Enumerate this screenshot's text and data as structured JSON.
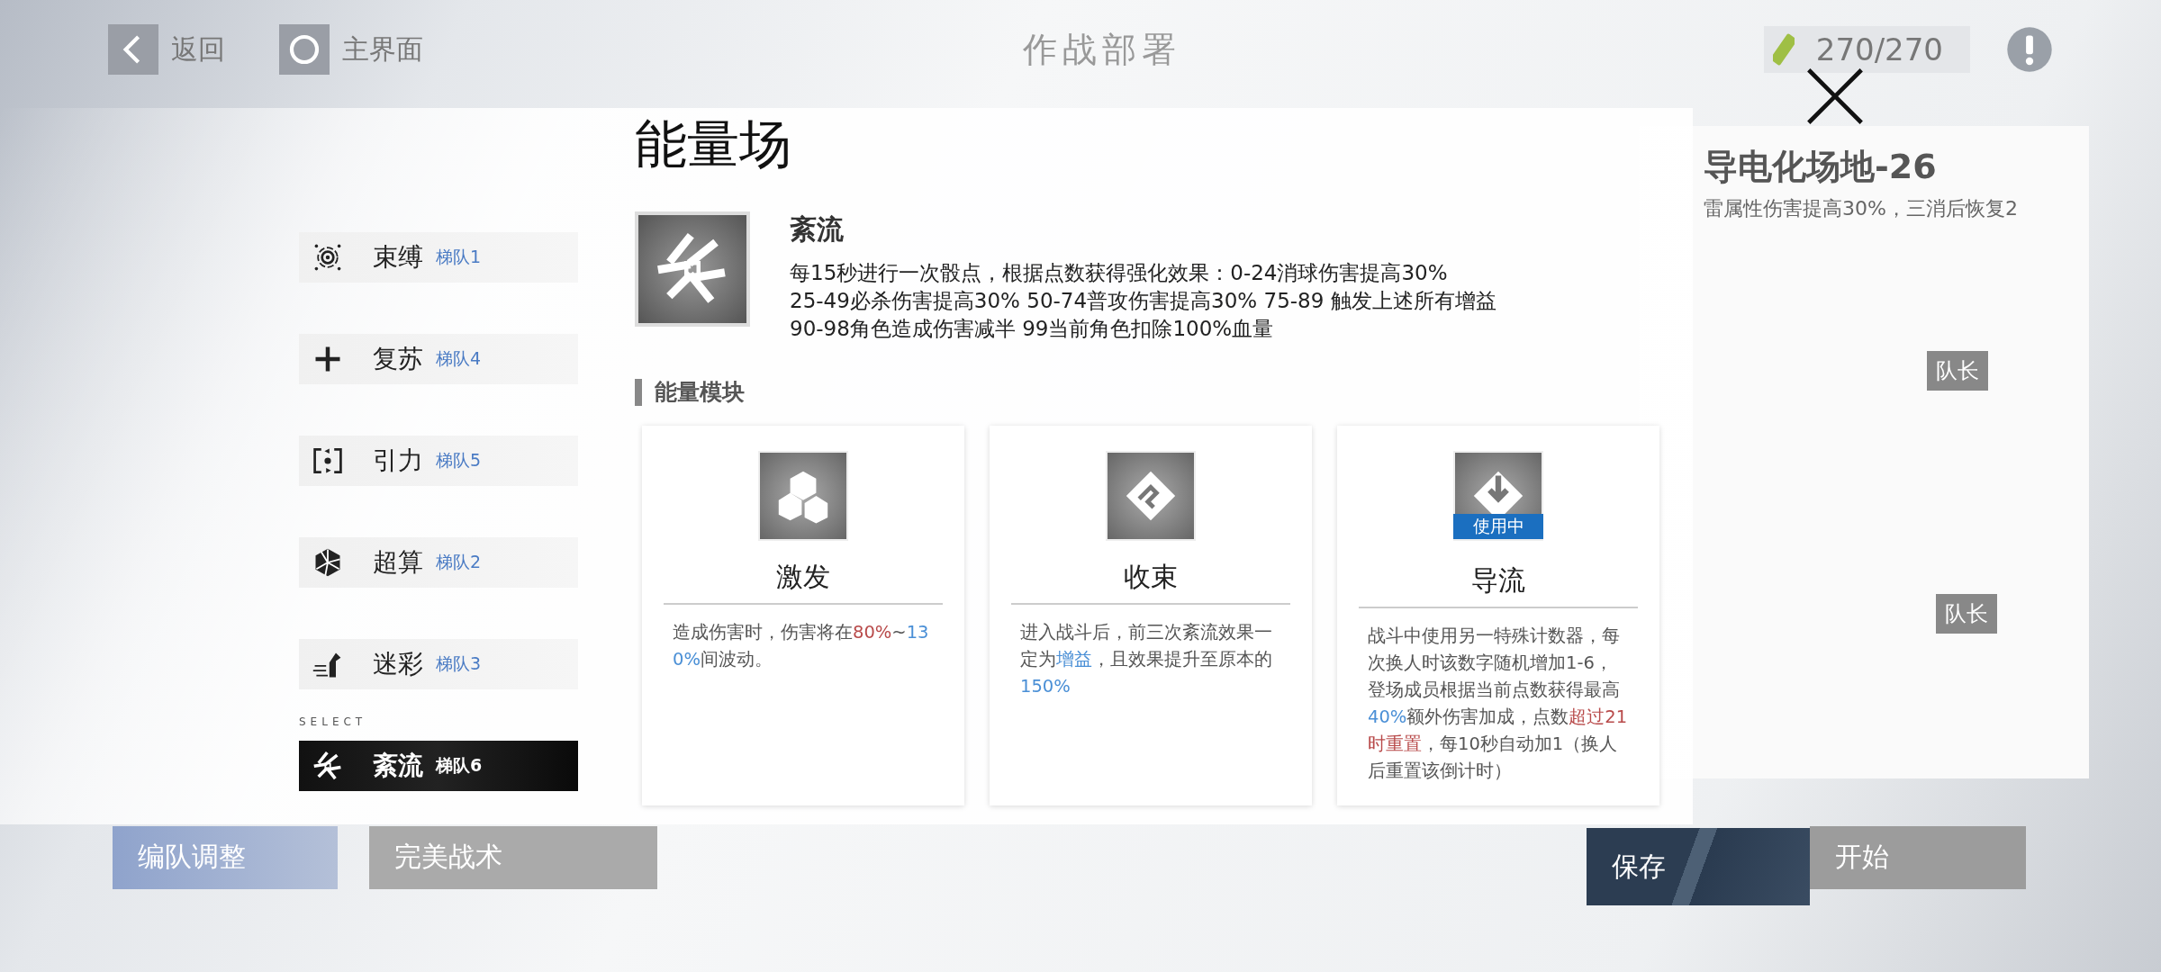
{
  "top_bar": {
    "back_label": "返回",
    "home_label": "主界面",
    "title": "作战部署",
    "stamina": "270/270"
  },
  "stage": {
    "name": "导电化场地-26",
    "effect": "雷属性伤害提高30%，三消后恢复2",
    "leader_tags": [
      "队长",
      "队长"
    ]
  },
  "bottom_bar": [
    {
      "label": "编队调整",
      "kind": "formation"
    },
    {
      "label": "完美战术",
      "kind": "tactic"
    },
    {
      "label": "开始",
      "kind": "start"
    }
  ],
  "dialog": {
    "title": "能量场",
    "select_label": "SELECT",
    "teams": [
      {
        "name": "束缚",
        "team": "梯队1",
        "selected": false
      },
      {
        "name": "复苏",
        "team": "梯队4",
        "selected": false
      },
      {
        "name": "引力",
        "team": "梯队5",
        "selected": false
      },
      {
        "name": "超算",
        "team": "梯队2",
        "selected": false
      },
      {
        "name": "迷彩",
        "team": "梯队3",
        "selected": false
      },
      {
        "name": "紊流",
        "team": "梯队6",
        "selected": true
      }
    ],
    "field": {
      "name": "紊流",
      "description": [
        "每15秒进行一次骰点，根据点数获得强化效果：0-24消球伤害提高30%",
        "25-49必杀伤害提高30% 50-74普攻伤害提高30% 75-89 触发上述所有增益",
        "90-98角色造成伤害减半 99当前角色扣除100%血量"
      ]
    },
    "section_title": "能量模块",
    "in_use_label": "使用中",
    "modules": [
      {
        "name": "激发",
        "in_use": false,
        "description": [
          {
            "text": "造成伤害时，伤害将在",
            "kind": "plain"
          },
          {
            "text": "80%",
            "kind": "warning"
          },
          {
            "text": "~",
            "kind": "plain"
          },
          {
            "text": "130%",
            "kind": "value"
          },
          {
            "text": "间波动。",
            "kind": "plain"
          }
        ]
      },
      {
        "name": "收束",
        "in_use": false,
        "description": [
          {
            "text": "进入战斗后，前三次紊流效果一定为",
            "kind": "plain"
          },
          {
            "text": "增益",
            "kind": "value"
          },
          {
            "text": "，且效果提升至原本的",
            "kind": "plain"
          },
          {
            "text": "150%",
            "kind": "value"
          }
        ]
      },
      {
        "name": "导流",
        "in_use": true,
        "description": [
          {
            "text": "战斗中使用另一特殊计数器，每次换人时该数字随机增加1-6，登场成员根据当前点数获得最高",
            "kind": "plain"
          },
          {
            "text": "40%",
            "kind": "value"
          },
          {
            "text": "额外伤害加成，点数",
            "kind": "plain"
          },
          {
            "text": "超过21时重置",
            "kind": "warning"
          },
          {
            "text": "，每10秒自动加1（换人后重置该倒计时）",
            "kind": "plain"
          }
        ]
      }
    ],
    "save_label": "保存"
  }
}
